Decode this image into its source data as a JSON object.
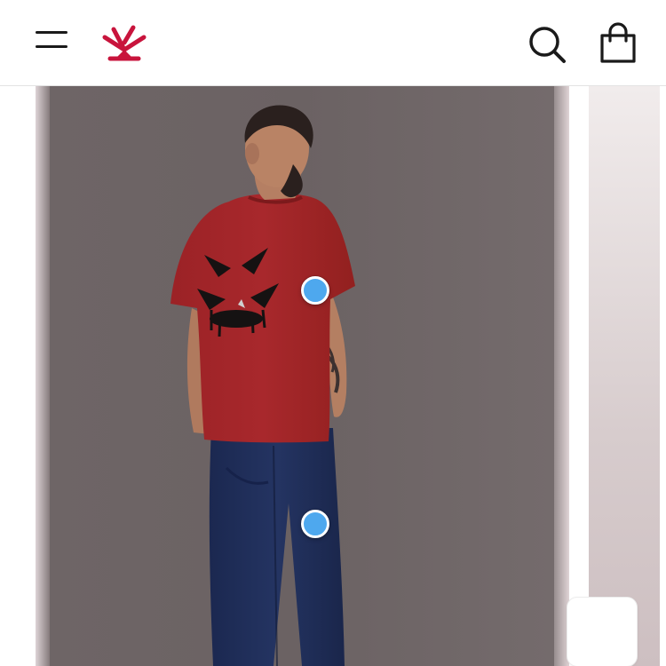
{
  "header": {
    "menu_icon": "hamburger-menu-icon",
    "logo_icon": "brand-logo-icon",
    "brand_color": "#c8143c",
    "search_icon": "search-icon",
    "bag_icon": "shopping-bag-icon"
  },
  "gallery": {
    "product": {
      "tshirt_color": "#a1262a",
      "pants_color": "#1f2d55"
    },
    "hotspot_color": "#4ea8ee",
    "hotspots": [
      {
        "target": "t-shirt"
      },
      {
        "target": "pants"
      }
    ]
  }
}
